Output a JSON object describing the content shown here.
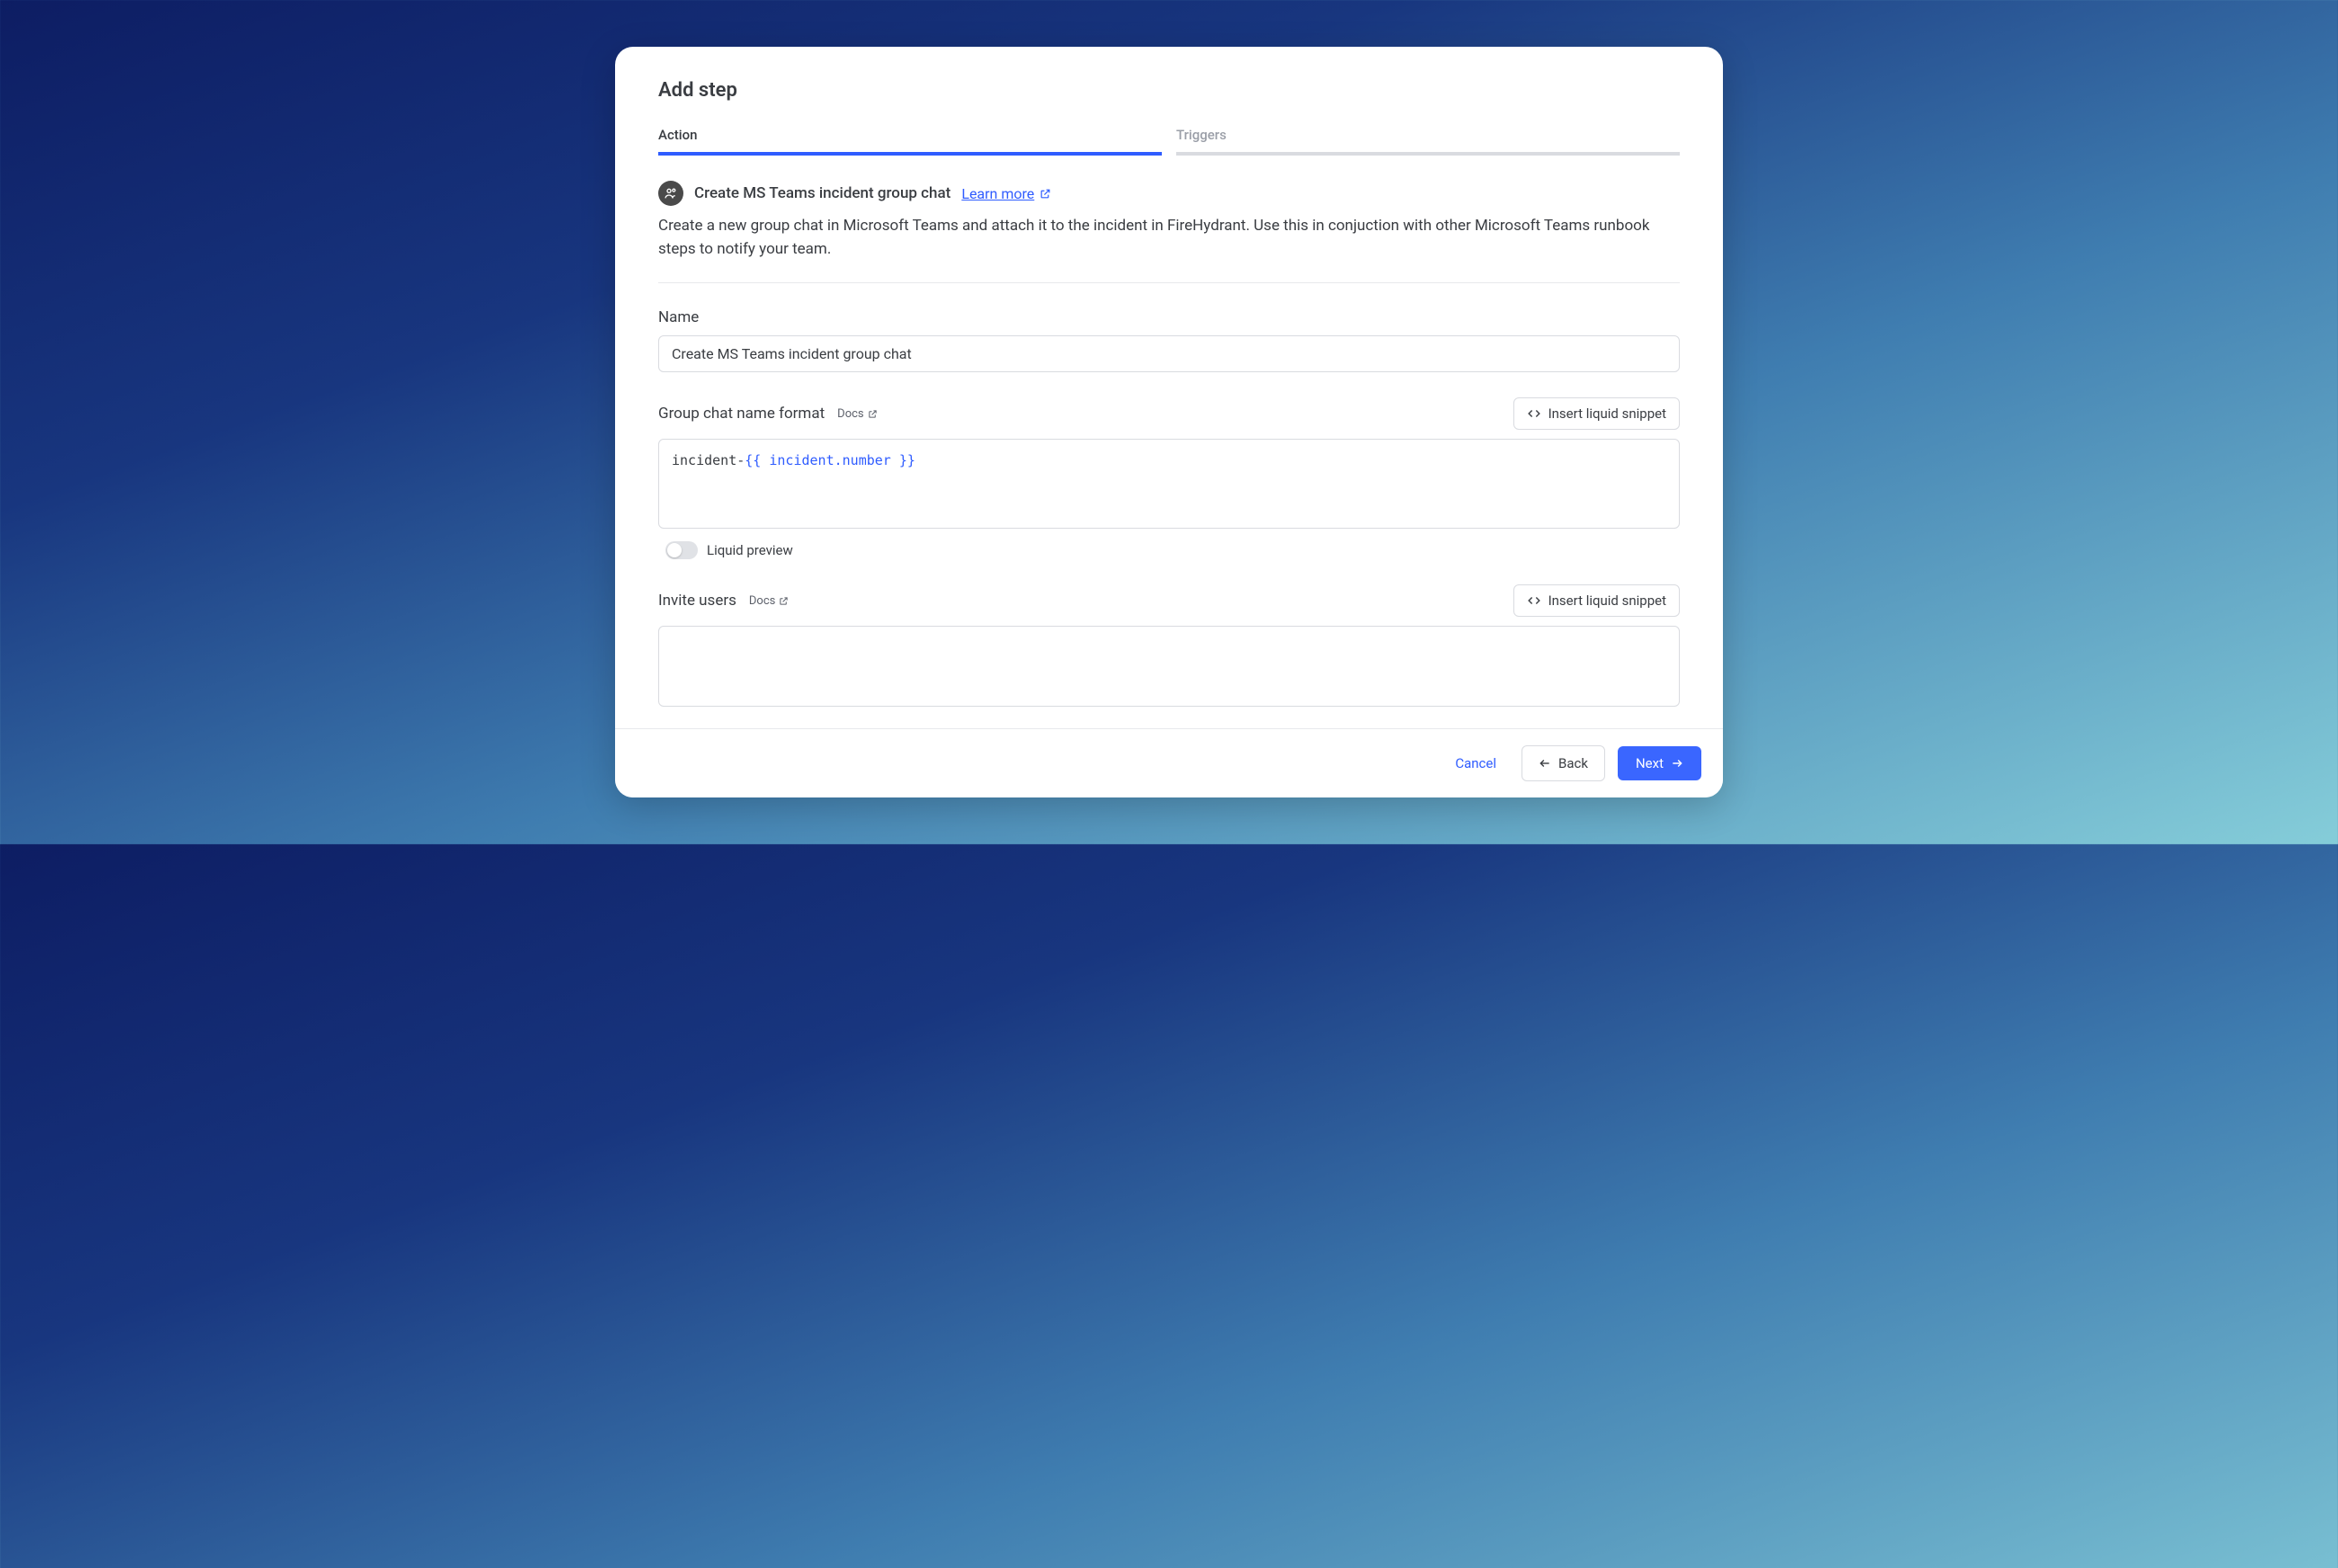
{
  "header": {
    "title": "Add step"
  },
  "tabs": {
    "action": "Action",
    "triggers": "Triggers"
  },
  "step": {
    "title": "Create MS Teams incident group chat",
    "learn_more": "Learn more",
    "description": "Create a new group chat in Microsoft Teams and attach it to the incident in FireHydrant. Use this in conjuction with other Microsoft Teams runbook steps to notify your team."
  },
  "fields": {
    "name": {
      "label": "Name",
      "value": "Create MS Teams incident group chat"
    },
    "group_chat_format": {
      "label": "Group chat name format",
      "docs": "Docs",
      "insert_snippet": "Insert liquid snippet",
      "value_plain": "incident-",
      "value_liquid": "{{ incident.number }}"
    },
    "liquid_preview": {
      "label": "Liquid preview"
    },
    "invite_users": {
      "label": "Invite users",
      "docs": "Docs",
      "insert_snippet": "Insert liquid snippet",
      "value": ""
    }
  },
  "footer": {
    "cancel": "Cancel",
    "back": "Back",
    "next": "Next"
  }
}
